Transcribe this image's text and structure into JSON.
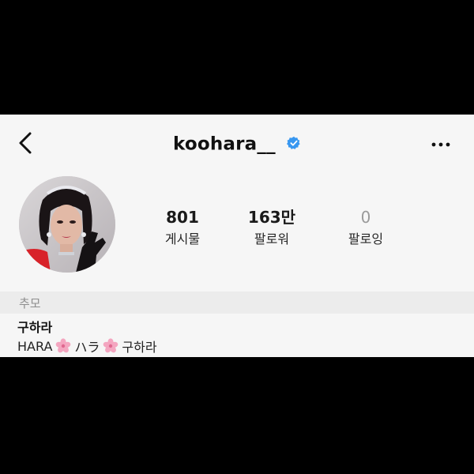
{
  "header": {
    "username": "koohara__",
    "back_icon": "chevron-left-icon",
    "verified_icon": "verified-badge-icon",
    "verified_color": "#3897f0",
    "more_icon": "more-horizontal-icon"
  },
  "stats": {
    "posts": {
      "value": "801",
      "label": "게시물"
    },
    "followers": {
      "value": "163만",
      "label": "팔로워"
    },
    "following": {
      "value": "0",
      "label": "팔로잉"
    }
  },
  "memorial": {
    "label": "추모"
  },
  "bio": {
    "name": "구하라",
    "parts": [
      "HARA",
      "ハラ",
      "구하라"
    ],
    "separator_icon": "cherry-blossom-icon",
    "separator_color": "#f4a6c0"
  }
}
